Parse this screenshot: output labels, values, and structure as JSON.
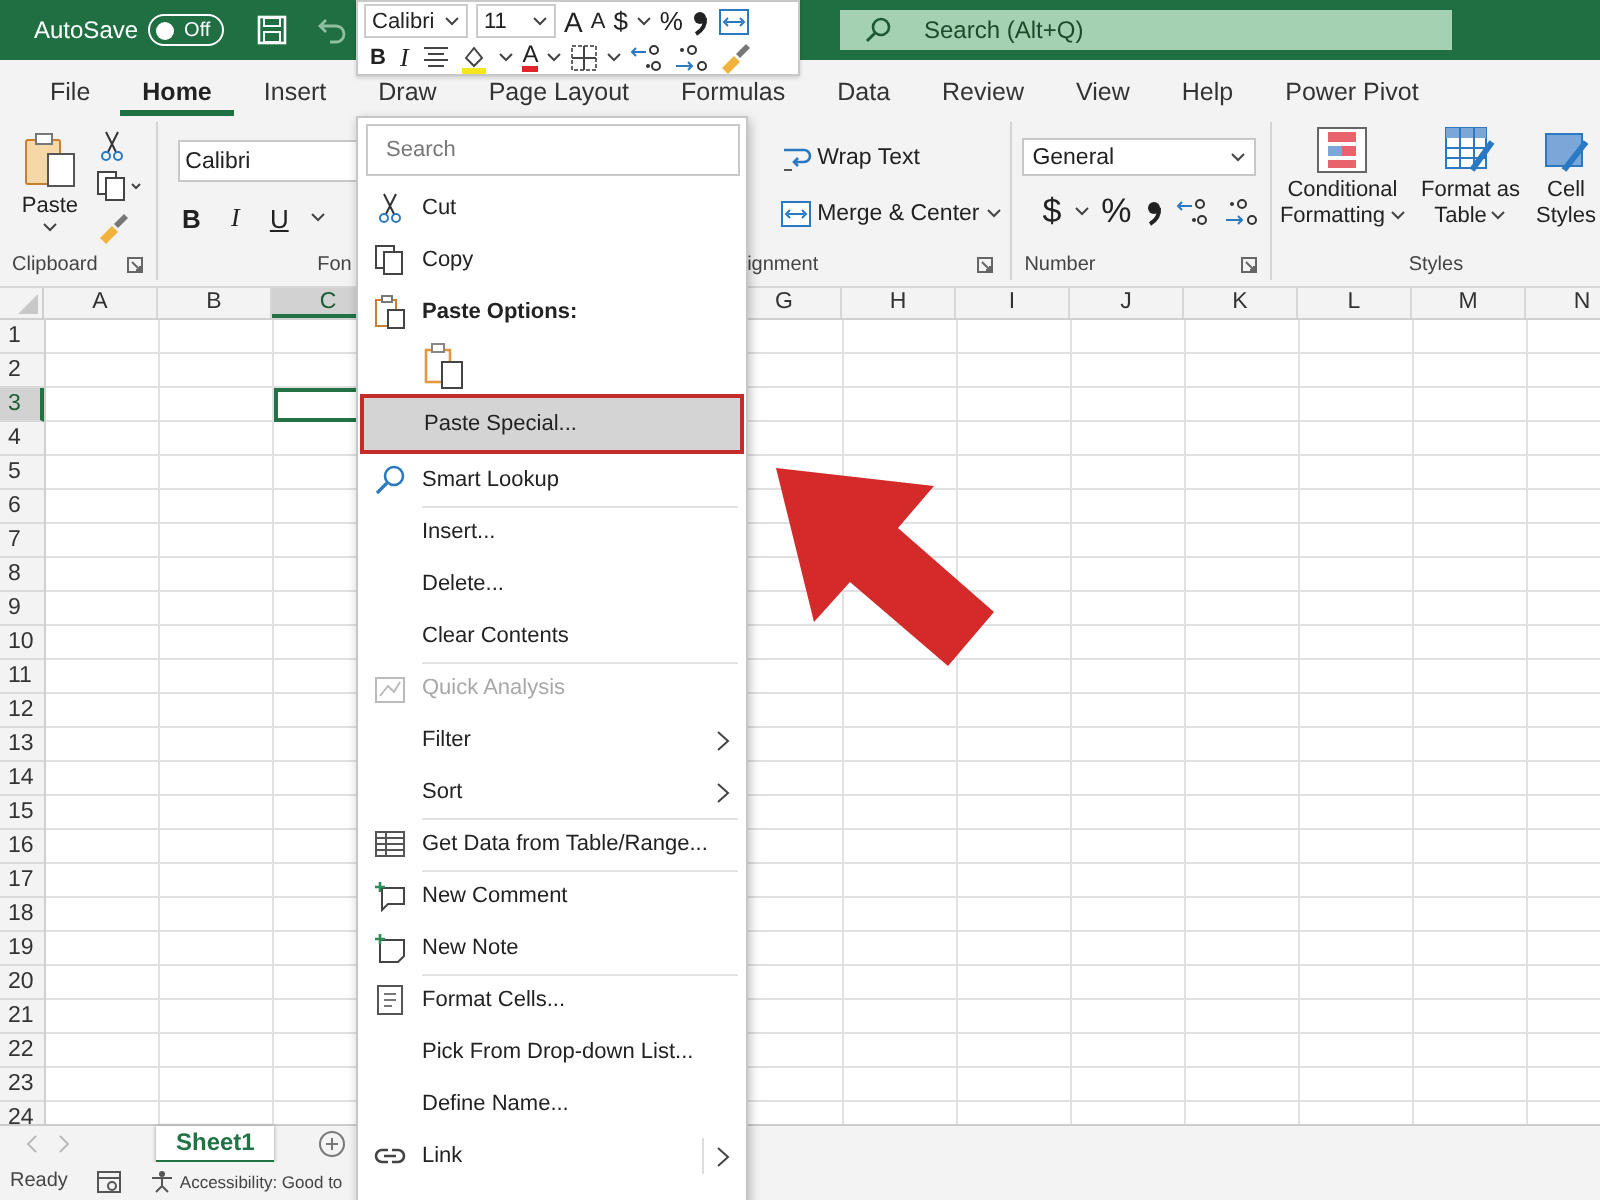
{
  "title_bar": {
    "autosave_label": "AutoSave",
    "autosave_on": false,
    "autosave_state": "Off",
    "search_placeholder": "Search (Alt+Q)"
  },
  "ribbon_tabs": [
    {
      "label": "File",
      "selected": false
    },
    {
      "label": "Home",
      "selected": true
    },
    {
      "label": "Insert",
      "selected": false
    },
    {
      "label": "Draw",
      "selected": false
    },
    {
      "label": "Page Layout",
      "selected": false
    },
    {
      "label": "Formulas",
      "selected": false
    },
    {
      "label": "Data",
      "selected": false
    },
    {
      "label": "Review",
      "selected": false
    },
    {
      "label": "View",
      "selected": false
    },
    {
      "label": "Help",
      "selected": false
    },
    {
      "label": "Power Pivot",
      "selected": false
    }
  ],
  "mini_toolbar": {
    "font": "Calibri",
    "size": "11",
    "grow_font": "A",
    "shrink_font": "A",
    "currency": "$",
    "percent": "%",
    "bold": "B",
    "italic": "I",
    "font_color": "A"
  },
  "ribbon": {
    "clipboard": {
      "paste": "Paste",
      "label": "Clipboard"
    },
    "font": {
      "font_name": "Calibri",
      "bold": "B",
      "italic": "I",
      "underline": "U",
      "label": "Fon"
    },
    "alignment": {
      "wrap_text": "Wrap Text",
      "merge": "Merge & Center",
      "label": "ignment"
    },
    "number": {
      "format": "General",
      "currency": "$",
      "percent": "%",
      "label": "Number"
    },
    "styles": {
      "buttons": [
        {
          "lines": [
            "Conditional",
            "Formatting"
          ],
          "caret": true
        },
        {
          "lines": [
            "Format as",
            "Table"
          ],
          "caret": true
        },
        {
          "lines": [
            "Cell",
            "Styles"
          ],
          "caret": false
        }
      ],
      "label": "Styles"
    }
  },
  "sheet": {
    "columns": [
      {
        "label": "A",
        "selected": false
      },
      {
        "label": "B",
        "selected": false
      },
      {
        "label": "C",
        "selected": true
      },
      {
        "label": "G",
        "selected": false
      },
      {
        "label": "H",
        "selected": false
      },
      {
        "label": "I",
        "selected": false
      },
      {
        "label": "J",
        "selected": false
      },
      {
        "label": "K",
        "selected": false
      },
      {
        "label": "L",
        "selected": false
      },
      {
        "label": "M",
        "selected": false
      },
      {
        "label": "N",
        "selected": false
      }
    ],
    "rows": [
      {
        "label": "1",
        "selected": false
      },
      {
        "label": "2",
        "selected": false
      },
      {
        "label": "3",
        "selected": true
      },
      {
        "label": "4",
        "selected": false
      },
      {
        "label": "5",
        "selected": false
      },
      {
        "label": "6",
        "selected": false
      },
      {
        "label": "7",
        "selected": false
      },
      {
        "label": "8",
        "selected": false
      },
      {
        "label": "9",
        "selected": false
      },
      {
        "label": "10",
        "selected": false
      },
      {
        "label": "11",
        "selected": false
      },
      {
        "label": "12",
        "selected": false
      },
      {
        "label": "13",
        "selected": false
      },
      {
        "label": "14",
        "selected": false
      },
      {
        "label": "15",
        "selected": false
      },
      {
        "label": "16",
        "selected": false
      },
      {
        "label": "17",
        "selected": false
      },
      {
        "label": "18",
        "selected": false
      },
      {
        "label": "19",
        "selected": false
      },
      {
        "label": "20",
        "selected": false
      },
      {
        "label": "21",
        "selected": false
      },
      {
        "label": "22",
        "selected": false
      },
      {
        "label": "23",
        "selected": false
      },
      {
        "label": "24",
        "selected": false
      }
    ]
  },
  "context_menu": {
    "search_placeholder": "Search",
    "items": [
      {
        "kind": "item",
        "label": "Cut",
        "selected": false,
        "disabled": false,
        "submenu": false,
        "group_start": false
      },
      {
        "kind": "item",
        "label": "Copy",
        "selected": false,
        "disabled": false,
        "submenu": false,
        "group_start": false
      },
      {
        "kind": "header",
        "label": "Paste Options:"
      },
      {
        "kind": "paste-icons"
      },
      {
        "kind": "item",
        "label": "Paste Special...",
        "selected": true,
        "disabled": false,
        "submenu": false,
        "group_start": false
      },
      {
        "kind": "item",
        "label": "Smart Lookup",
        "selected": false,
        "disabled": false,
        "submenu": false,
        "group_start": false
      },
      {
        "kind": "item",
        "label": "Insert...",
        "selected": false,
        "disabled": false,
        "submenu": false,
        "group_start": true
      },
      {
        "kind": "item",
        "label": "Delete...",
        "selected": false,
        "disabled": false,
        "submenu": false,
        "group_start": false
      },
      {
        "kind": "item",
        "label": "Clear Contents",
        "selected": false,
        "disabled": false,
        "submenu": false,
        "group_start": false
      },
      {
        "kind": "item",
        "label": "Quick Analysis",
        "selected": false,
        "disabled": true,
        "submenu": false,
        "group_start": true
      },
      {
        "kind": "item",
        "label": "Filter",
        "selected": false,
        "disabled": false,
        "submenu": true,
        "group_start": false
      },
      {
        "kind": "item",
        "label": "Sort",
        "selected": false,
        "disabled": false,
        "submenu": true,
        "group_start": false
      },
      {
        "kind": "item",
        "label": "Get Data from Table/Range...",
        "selected": false,
        "disabled": false,
        "submenu": false,
        "group_start": true
      },
      {
        "kind": "item",
        "label": "New Comment",
        "selected": false,
        "disabled": false,
        "submenu": false,
        "group_start": true
      },
      {
        "kind": "item",
        "label": "New Note",
        "selected": false,
        "disabled": false,
        "submenu": false,
        "group_start": false
      },
      {
        "kind": "item",
        "label": "Format Cells...",
        "selected": false,
        "disabled": false,
        "submenu": false,
        "group_start": true
      },
      {
        "kind": "item",
        "label": "Pick From Drop-down List...",
        "selected": false,
        "disabled": false,
        "submenu": false,
        "group_start": false
      },
      {
        "kind": "item",
        "label": "Define Name...",
        "selected": false,
        "disabled": false,
        "submenu": false,
        "group_start": false
      },
      {
        "kind": "item",
        "label": "Link",
        "selected": false,
        "disabled": false,
        "submenu": true,
        "group_start": false
      }
    ]
  },
  "sheet_tabs": [
    {
      "label": "Sheet1",
      "selected": true
    }
  ],
  "status_bar": {
    "mode": "Ready",
    "accessibility": "Accessibility: Good to"
  }
}
